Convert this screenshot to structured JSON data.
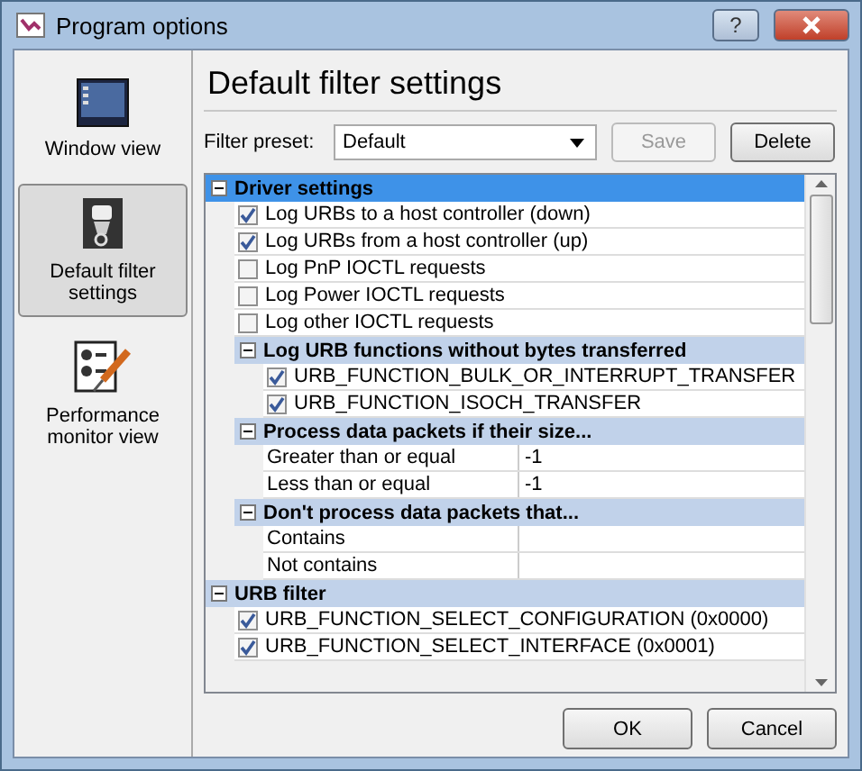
{
  "window": {
    "title": "Program options",
    "help_button": "?"
  },
  "sidebar": {
    "items": [
      {
        "label": "Window view",
        "kind": "window",
        "selected": false
      },
      {
        "label": "Default filter settings",
        "kind": "filter",
        "selected": true
      },
      {
        "label": "Performance monitor view",
        "kind": "monitor",
        "selected": false
      }
    ]
  },
  "heading": "Default filter settings",
  "filter_preset": {
    "label": "Filter preset:",
    "value": "Default"
  },
  "preset_buttons": [
    {
      "label": "Save",
      "disabled": true
    },
    {
      "label": "Delete",
      "disabled": false
    }
  ],
  "tree": [
    {
      "kind": "group",
      "label": "Driver settings",
      "expanded": true,
      "selected": true,
      "children": [
        {
          "kind": "check",
          "label": "Log URBs to a host controller (down)",
          "checked": true
        },
        {
          "kind": "check",
          "label": "Log URBs from a host controller (up)",
          "checked": true
        },
        {
          "kind": "check",
          "label": "Log PnP IOCTL requests",
          "checked": false
        },
        {
          "kind": "check",
          "label": "Log Power IOCTL requests",
          "checked": false
        },
        {
          "kind": "check",
          "label": "Log other IOCTL requests",
          "checked": false
        },
        {
          "kind": "group",
          "label": "Log URB functions without bytes transferred",
          "expanded": true,
          "selected": false,
          "children": [
            {
              "kind": "check",
              "label": "URB_FUNCTION_BULK_OR_INTERRUPT_TRANSFER",
              "checked": true
            },
            {
              "kind": "check",
              "label": "URB_FUNCTION_ISOCH_TRANSFER",
              "checked": true
            }
          ]
        },
        {
          "kind": "group",
          "label": "Process data packets if their size...",
          "expanded": true,
          "selected": false,
          "children": [
            {
              "kind": "field",
              "label": "Greater than or equal",
              "value": "-1"
            },
            {
              "kind": "field",
              "label": "Less than or equal",
              "value": "-1"
            }
          ]
        },
        {
          "kind": "group",
          "label": "Don't process data packets that...",
          "expanded": true,
          "selected": false,
          "children": [
            {
              "kind": "field",
              "label": "Contains"
            },
            {
              "kind": "field",
              "label": "Not contains"
            }
          ]
        }
      ]
    },
    {
      "kind": "group",
      "label": "URB filter",
      "expanded": true,
      "selected": false,
      "children": [
        {
          "kind": "check",
          "label": "URB_FUNCTION_SELECT_CONFIGURATION (0x0000)",
          "checked": true
        },
        {
          "kind": "check",
          "label": "URB_FUNCTION_SELECT_INTERFACE (0x0001)",
          "checked": true
        }
      ]
    }
  ],
  "dialog_buttons": [
    {
      "label": "OK"
    },
    {
      "label": "Cancel"
    }
  ]
}
